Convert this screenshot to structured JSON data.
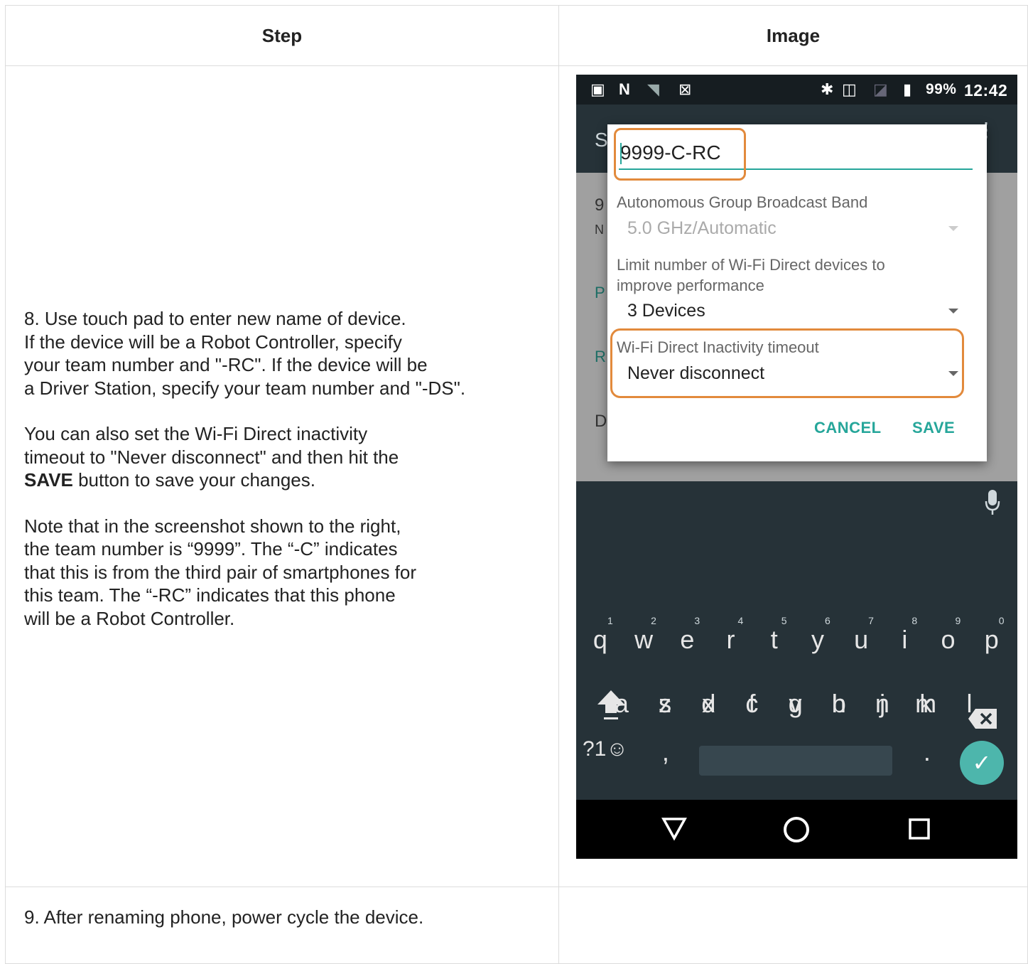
{
  "table": {
    "headers": [
      "Step",
      "Image"
    ]
  },
  "step8": {
    "para1_lines": [
      "8. Use touch pad to enter new name of device.",
      "If the device will be a Robot Controller, specify",
      "your team number and \"-RC\". If the device will be",
      "a Driver Station, specify your team number and \"-DS\"."
    ],
    "para2_lines": [
      "You can also set the Wi-Fi Direct inactivity",
      "timeout to \"Never disconnect\" and then hit the"
    ],
    "para2_bold": "SAVE",
    "para2_tail": " button to save your changes.",
    "para3_lines": [
      "Note that in the screenshot shown to the right,",
      "the team number is “9999”. The “-C” indicates",
      "that this is from the third pair of smartphones for",
      "this team. The “-RC” indicates that this phone",
      "will be a Robot Controller."
    ]
  },
  "step9": {
    "text": "9. After renaming phone, power cycle the device."
  },
  "phone": {
    "status": {
      "battery": "99%",
      "time": "12:42"
    },
    "appbar_letter": "S",
    "bg_letters": [
      "9",
      "N",
      "P",
      "R",
      "D"
    ],
    "dialog": {
      "name_value": "9999-C-RC",
      "band_label": "Autonomous Group Broadcast Band",
      "band_value": "5.0 GHz/Automatic",
      "limit_label_1": "Limit number of Wi-Fi Direct devices to",
      "limit_label_2": "improve performance",
      "limit_value": "3 Devices",
      "timeout_label": "Wi-Fi Direct Inactivity timeout",
      "timeout_value": "Never disconnect",
      "cancel": "CANCEL",
      "save": "SAVE"
    },
    "keyboard": {
      "row1": [
        "q",
        "w",
        "e",
        "r",
        "t",
        "y",
        "u",
        "i",
        "o",
        "p"
      ],
      "row1_hints": [
        "1",
        "2",
        "3",
        "4",
        "5",
        "6",
        "7",
        "8",
        "9",
        "0"
      ],
      "row2": [
        "a",
        "s",
        "d",
        "f",
        "g",
        "h",
        "j",
        "k",
        "l"
      ],
      "row3": [
        "z",
        "x",
        "c",
        "v",
        "b",
        "n",
        "m"
      ],
      "symbols": "?1☺",
      "comma": ",",
      "period": "."
    }
  },
  "colors": {
    "accent": "#26a69a",
    "highlight": "#e28a3c",
    "keyboard_bg": "#263238"
  }
}
